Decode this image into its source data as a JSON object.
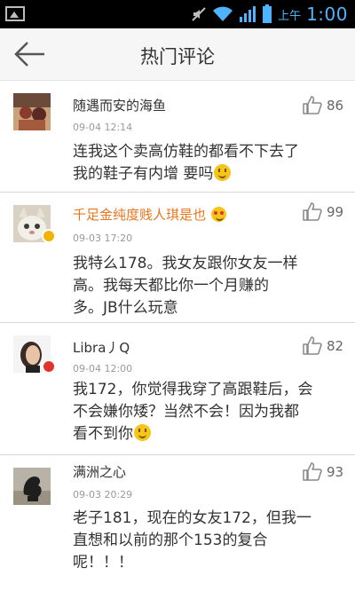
{
  "status_bar": {
    "ampm": "上午",
    "time": "1:00"
  },
  "header": {
    "title": "热门评论"
  },
  "comments": [
    {
      "username": "随遇而安的海鱼",
      "date": "09-04 12:14",
      "likes": "86",
      "lines": [
        "连我这个卖高仿鞋的都看不下去了",
        "我的鞋子有内增 要吗"
      ],
      "vip": false
    },
    {
      "username": "千足金纯度贱人琪是也",
      "date": "09-03 17:20",
      "likes": "99",
      "lines": [
        "我特么178。我女友跟你女友一样",
        "高。我每天都比你一个月赚的",
        "多。JB什么玩意"
      ],
      "vip": true
    },
    {
      "username": "Libra丿Q",
      "date": "09-04 12:00",
      "likes": "82",
      "lines": [
        "我172，你觉得我穿了高跟鞋后，会",
        "不会嫌你矮？当然不会！因为我都",
        "看不到你"
      ],
      "vip": false
    },
    {
      "username": "满洲之心",
      "date": "09-03 20:29",
      "likes": "93",
      "lines": [
        "老子181，现在的女友172，但我一",
        "直想和以前的那个153的复合",
        "呢！！！"
      ],
      "vip": false
    }
  ],
  "colors": {
    "status_bar_bg": "#000000",
    "status_accent": "#4fb4ff",
    "vip_name": "#e8761c",
    "badge_yellow": "#f0b400",
    "badge_red": "#e2322d"
  }
}
